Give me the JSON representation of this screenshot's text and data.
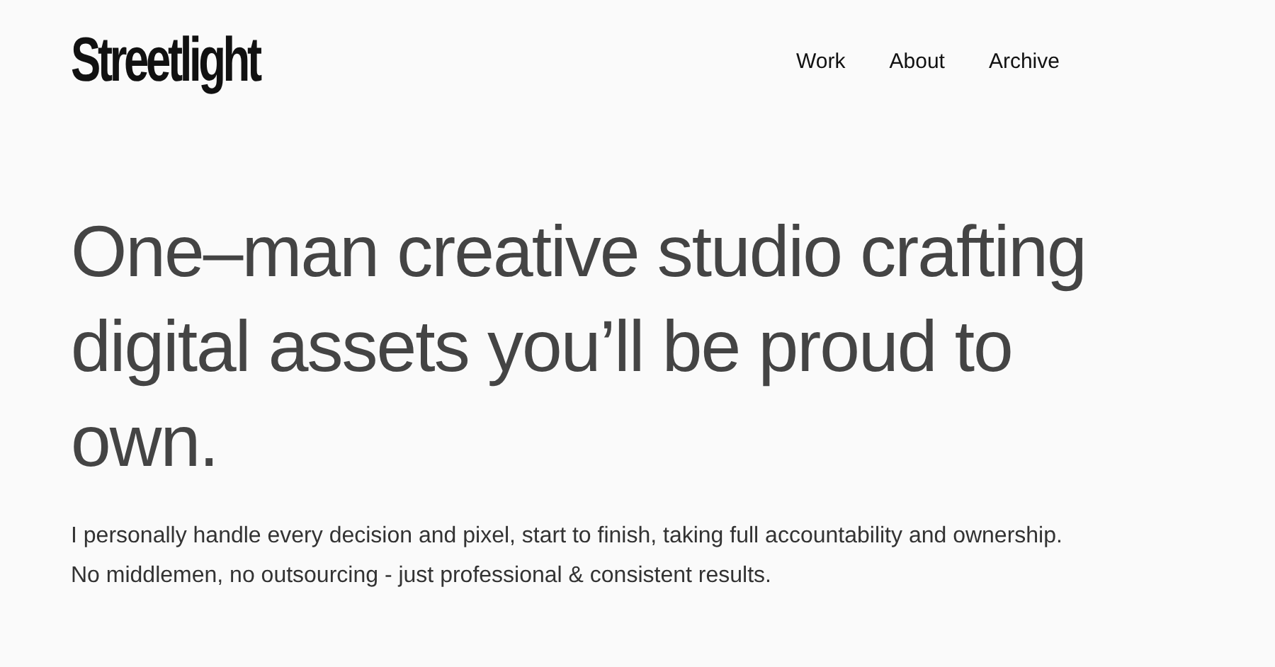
{
  "logo": "Streetlight",
  "nav": [
    {
      "label": "Work"
    },
    {
      "label": "About"
    },
    {
      "label": "Archive"
    }
  ],
  "headline": "One–man creative studio crafting digital assets you’ll be proud to own.",
  "intro": "I personally handle every decision and pixel, start to finish, taking full accountability and ownership. No middlemen, no outsourcing - just professional & consistent results."
}
